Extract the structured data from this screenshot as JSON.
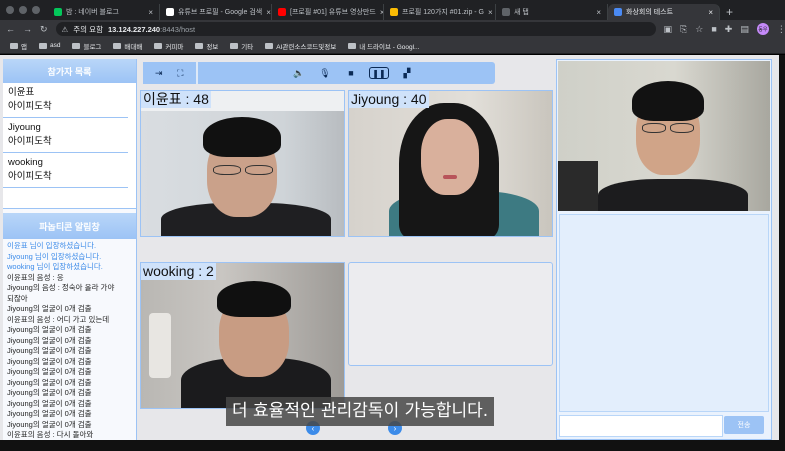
{
  "browser": {
    "tabs": [
      {
        "label": "밤 : 네이버 블로그",
        "color": "#03c75a",
        "active": false
      },
      {
        "label": "유튜브 프로필 - Google 검색",
        "color": "#ffffff",
        "active": false
      },
      {
        "label": "[프로필 #01] 유튜브 영상만드",
        "color": "#ff0000",
        "active": false
      },
      {
        "label": "프로필 120가지 #01.zip - G",
        "color": "#fbbc04",
        "active": false
      },
      {
        "label": "새 탭",
        "color": "#5f6368",
        "active": false
      },
      {
        "label": "화상회의 테스트",
        "color": "#4a8af4",
        "active": true
      }
    ],
    "new_tab": "+",
    "security_label": "주의 요함",
    "url_host": "13.124.227.240",
    "url_path": ":8443/host",
    "profile_initials": "동우",
    "bookmarks": [
      {
        "label": "앱",
        "icon": "apps-icon"
      },
      {
        "label": "asd",
        "icon": "globe-icon"
      },
      {
        "label": "블로그",
        "icon": "blog-icon"
      },
      {
        "label": "배대배",
        "icon": "folder-icon"
      },
      {
        "label": "커피마",
        "icon": "folder-icon"
      },
      {
        "label": "정보",
        "icon": "folder-icon"
      },
      {
        "label": "기타",
        "icon": "folder-icon"
      },
      {
        "label": "AI관련소스코드및정보",
        "icon": "folder-icon"
      },
      {
        "label": "내 드라이브 - Googl...",
        "icon": "drive-icon"
      }
    ]
  },
  "sidebar": {
    "participants_title": "참가자 목록",
    "participants": [
      {
        "name": "이윤표",
        "status": "아이피도착"
      },
      {
        "name": "Jiyoung",
        "status": "아이피도착"
      },
      {
        "name": "wooking",
        "status": "아이피도착"
      }
    ],
    "alarm_title": "파놉티콘 알림창",
    "log": [
      {
        "text": "이윤표 님이 입장하셨습니다.",
        "blue": true
      },
      {
        "text": "Jiyoung 님이 입장하셨습니다.",
        "blue": true
      },
      {
        "text": "wooking 님이 입장하셨습니다.",
        "blue": true
      },
      {
        "text": "이윤표의 음성 : 응",
        "blue": false
      },
      {
        "text": "Jiyoung의 음성 : 정숙아 올라 가야",
        "blue": false
      },
      {
        "text": "되잖아",
        "blue": false
      },
      {
        "text": "Jiyoung의 얼굴이 0개 검출",
        "blue": false
      },
      {
        "text": "이윤표의 음성 : 어디 가고 있는데",
        "blue": false
      },
      {
        "text": "Jiyoung의 얼굴이 0개 검출",
        "blue": false
      },
      {
        "text": "Jiyoung의 얼굴이 0개 검출",
        "blue": false
      },
      {
        "text": "Jiyoung의 얼굴이 0개 검출",
        "blue": false
      },
      {
        "text": "Jiyoung의 얼굴이 0개 검출",
        "blue": false
      },
      {
        "text": "Jiyoung의 얼굴이 0개 검출",
        "blue": false
      },
      {
        "text": "Jiyoung의 얼굴이 0개 검출",
        "blue": false
      },
      {
        "text": "Jiyoung의 얼굴이 0개 검출",
        "blue": false
      },
      {
        "text": "Jiyoung의 얼굴이 0개 검출",
        "blue": false
      },
      {
        "text": "Jiyoung의 얼굴이 0개 검출",
        "blue": false
      },
      {
        "text": "Jiyoung의 얼굴이 0개 검출",
        "blue": false
      },
      {
        "text": "이윤표의 음성 : 다시 돌아와",
        "blue": false
      }
    ]
  },
  "controls": {
    "left": [
      {
        "icon": "exit-icon",
        "glyph": "⇥"
      },
      {
        "icon": "fullscreen-icon",
        "glyph": "⛶"
      }
    ],
    "right": [
      {
        "icon": "speaker-icon",
        "glyph": "🔈"
      },
      {
        "icon": "microphone-icon",
        "glyph": "🎙"
      },
      {
        "icon": "camera-icon",
        "glyph": "■"
      },
      {
        "icon": "pause-icon",
        "glyph": "❚❚"
      },
      {
        "icon": "screen-share-icon",
        "glyph": "▞"
      }
    ]
  },
  "videos": [
    {
      "label": "이윤표 : 48"
    },
    {
      "label": "Jiyoung : 40"
    },
    {
      "label": "wooking : 2"
    }
  ],
  "subtitle": "더 효율적인 관리감독이 가능합니다.",
  "chat": {
    "send_label": "전송"
  }
}
